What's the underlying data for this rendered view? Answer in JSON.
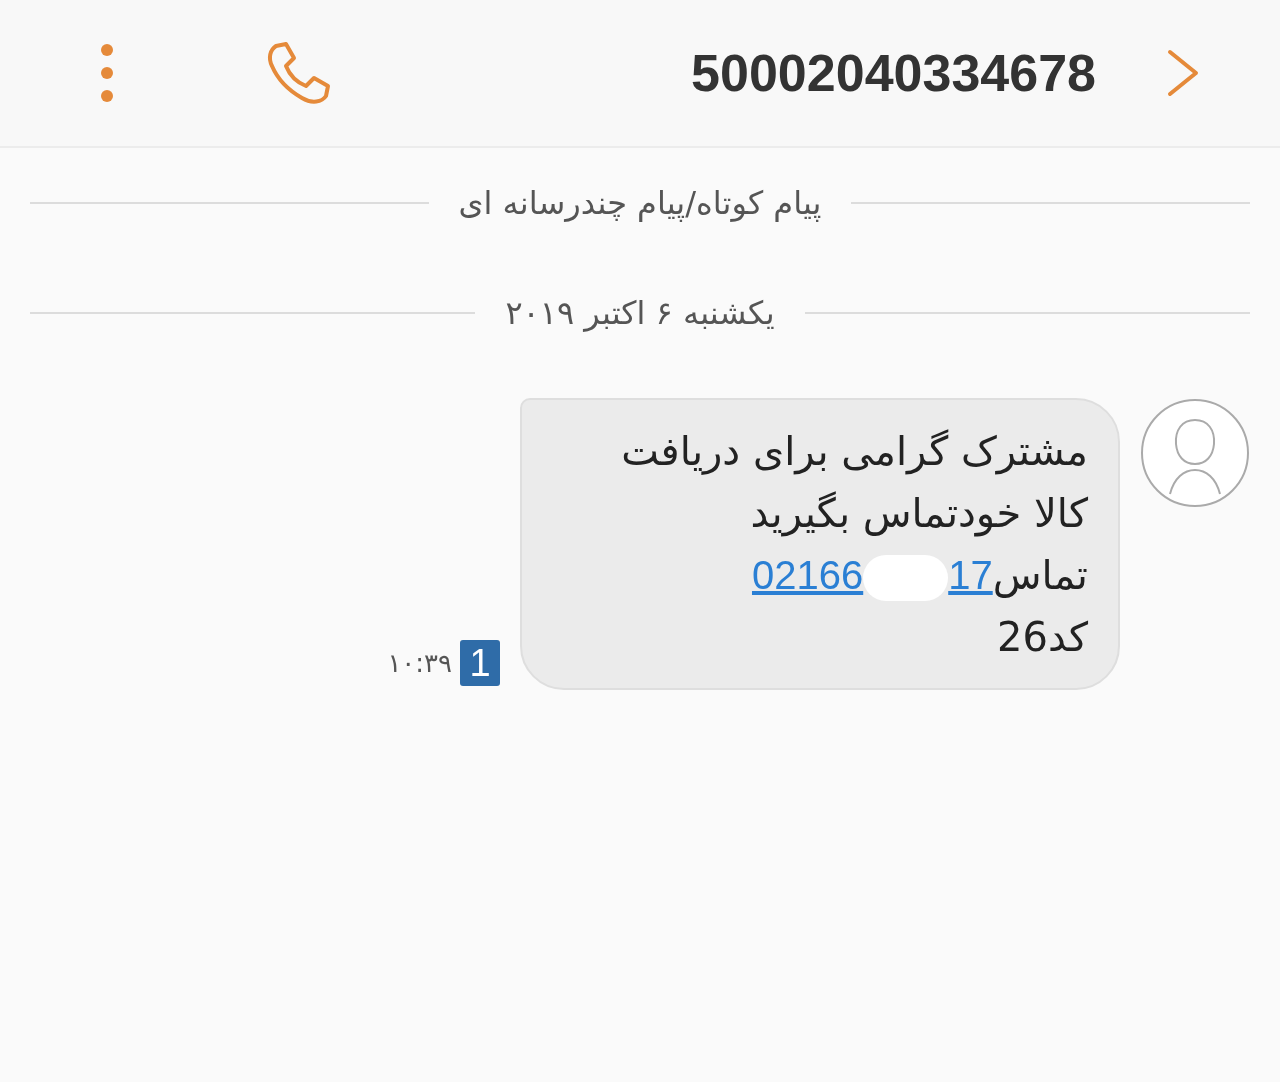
{
  "header": {
    "title": "50002040334678"
  },
  "dividers": [
    "پیام کوتاه/پیام چندرسانه ای",
    "یکشنبه ۶ اکتبر ۲۰۱۹"
  ],
  "messages": [
    {
      "lines": [
        "مشترک گرامی برای دریافت",
        "کالا خودتماس بگیرید"
      ],
      "call_label": "تماس",
      "link": {
        "start": "02166",
        "end": "17",
        "redacted": true
      },
      "code": "کد26",
      "sim": "1",
      "time": "۱۰:۳۹"
    }
  ]
}
